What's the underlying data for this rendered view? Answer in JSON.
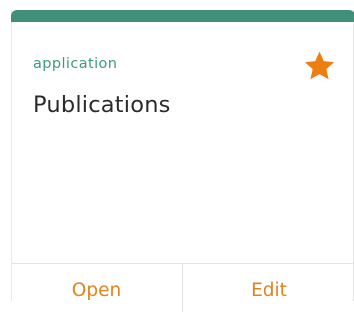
{
  "card": {
    "kind": "application",
    "title": "Publications",
    "favorite_icon": "star-icon",
    "favorite": true
  },
  "actions": {
    "open_label": "Open",
    "edit_label": "Edit"
  },
  "colors": {
    "accent": "#3f8f7a",
    "kind_text": "#3a9a82",
    "action_text": "#e2831e",
    "star": "#ee7d12"
  }
}
